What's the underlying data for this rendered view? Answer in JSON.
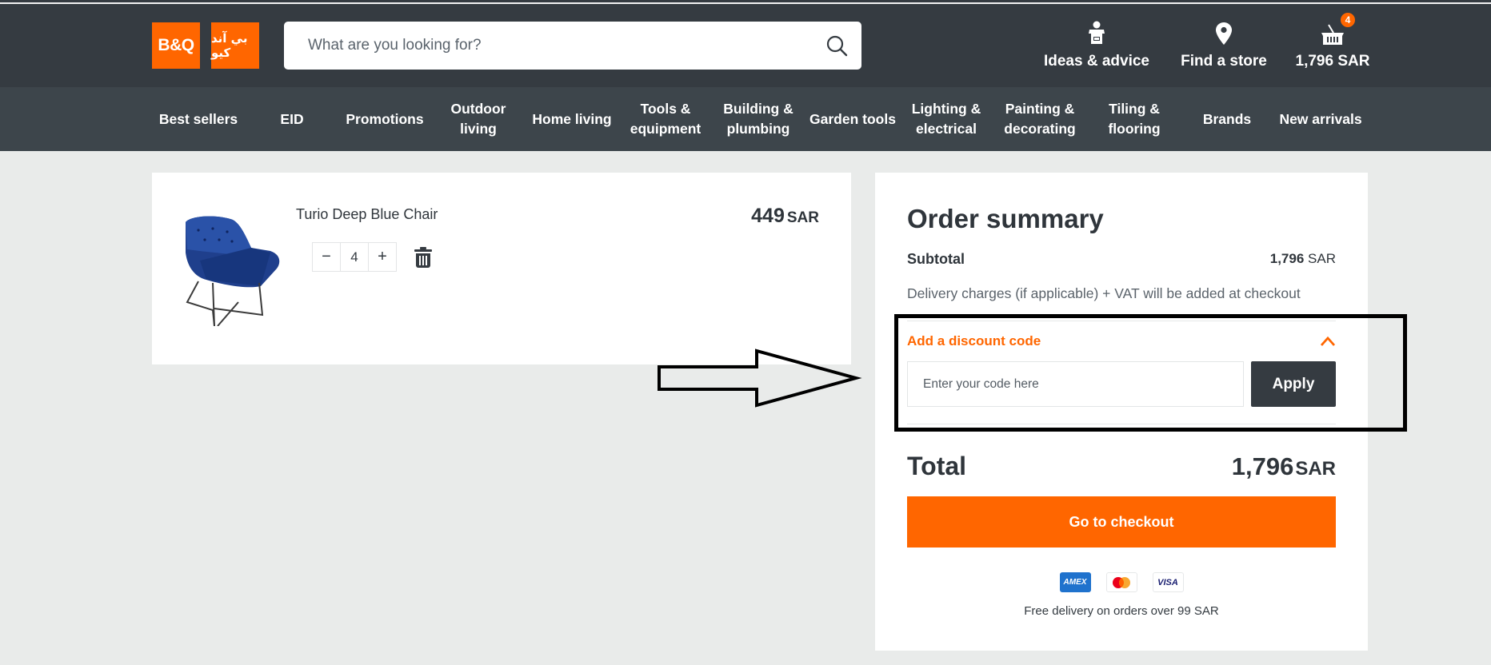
{
  "header": {
    "logo_en": "B&Q",
    "logo_ar": "بي آند كيو",
    "search_placeholder": "What are you looking for?",
    "ideas_label": "Ideas & advice",
    "store_label": "Find a store",
    "basket_total": "1,796 SAR",
    "basket_count": "4"
  },
  "nav": {
    "items": [
      {
        "label": "Best sellers"
      },
      {
        "label": "EID"
      },
      {
        "label": "Promotions"
      },
      {
        "label": "Outdoor living"
      },
      {
        "label": "Home living"
      },
      {
        "label": "Tools & equipment"
      },
      {
        "label": "Building & plumbing"
      },
      {
        "label": "Garden tools"
      },
      {
        "label": "Lighting & electrical"
      },
      {
        "label": "Painting & decorating"
      },
      {
        "label": "Tiling & flooring"
      },
      {
        "label": "Brands"
      },
      {
        "label": "New arrivals"
      }
    ]
  },
  "cart": {
    "item": {
      "name": "Turio Deep Blue Chair",
      "price": "449",
      "currency": "SAR",
      "quantity": "4",
      "minus": "−",
      "plus": "+"
    }
  },
  "summary": {
    "title": "Order summary",
    "subtotal_label": "Subtotal",
    "subtotal_value": "1,796",
    "currency": "SAR",
    "note": "Delivery charges (if applicable) + VAT will be added at checkout",
    "discount_title": "Add a discount code",
    "discount_placeholder": "Enter your code here",
    "apply_label": "Apply",
    "total_label": "Total",
    "total_value": "1,796",
    "checkout_label": "Go to checkout",
    "payment_methods": [
      "AMEX",
      "Mastercard",
      "VISA"
    ],
    "free_delivery": "Free delivery on orders over 99 SAR"
  },
  "colors": {
    "brand": "#ff6600",
    "header_bg": "#353b41",
    "nav_bg": "#3d454b",
    "page_bg": "#e9ebea"
  }
}
